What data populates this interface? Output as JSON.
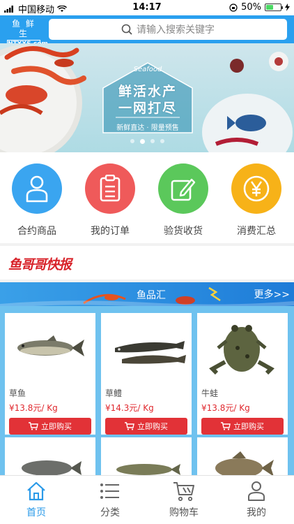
{
  "status_bar": {
    "carrier": "中国移动",
    "time": "14:17",
    "battery": "50%",
    "battery_level": 0.5
  },
  "header": {
    "logo_line1": "鱼 鲜 生",
    "logo_line2": "NTYXS.com",
    "search_placeholder": "请输入搜索关键字"
  },
  "banner": {
    "seafood": "Seafood",
    "title_line1": "鲜活水产",
    "title_line2": "一网打尽",
    "subtitle": "新鲜直达 · 限量预售",
    "slide_count": 4,
    "active_slide": 2
  },
  "quick_menu": [
    {
      "label": "合约商品",
      "icon": "user-icon",
      "color": "#3aa5f0"
    },
    {
      "label": "我的订单",
      "icon": "clipboard-icon",
      "color": "#ef5a5a"
    },
    {
      "label": "验货收货",
      "icon": "edit-icon",
      "color": "#5bc85b"
    },
    {
      "label": "消费汇总",
      "icon": "yen-icon",
      "color": "#f7b218"
    }
  ],
  "brand_banner": {
    "text": "鱼哥哥快报"
  },
  "section": {
    "title": "鱼品汇",
    "more": "更多>>"
  },
  "products": [
    {
      "name": "草鱼",
      "price": "¥13.8元/ Kg",
      "button": "立即购买"
    },
    {
      "name": "草鳢",
      "price": "¥14.3元/ Kg",
      "button": "立即购买"
    },
    {
      "name": "牛蛙",
      "price": "¥13.8元/ Kg",
      "button": "立即购买"
    }
  ],
  "tabbar": [
    {
      "label": "首页",
      "icon": "home-icon",
      "active": true
    },
    {
      "label": "分类",
      "icon": "list-icon",
      "active": false
    },
    {
      "label": "购物车",
      "icon": "cart-icon",
      "active": false
    },
    {
      "label": "我的",
      "icon": "profile-icon",
      "active": false
    }
  ],
  "colors": {
    "primary": "#2aa0ef",
    "buy_button": "#e23237",
    "price": "#e0282e",
    "products_bg": "#6fc2ef"
  }
}
